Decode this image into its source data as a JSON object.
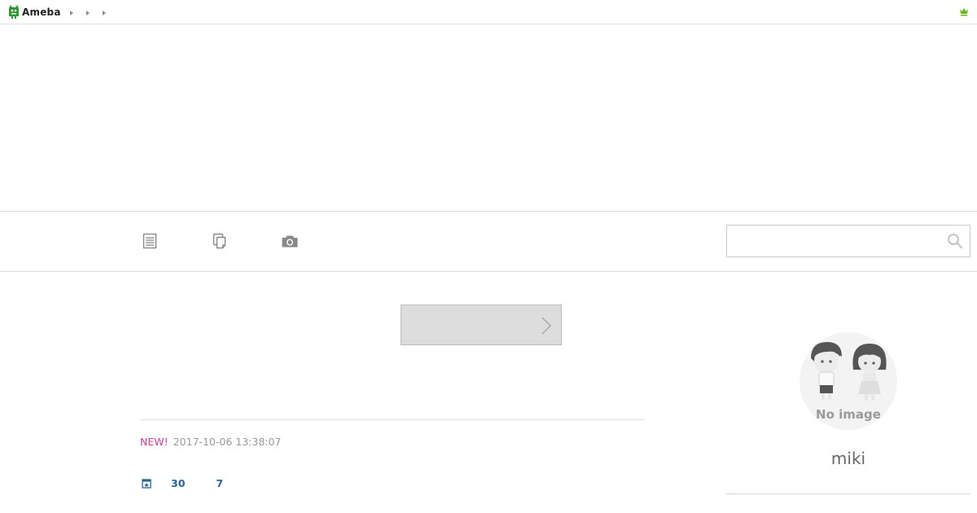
{
  "header": {
    "logo_text": "Ameba",
    "breadcrumbs": [
      "",
      "",
      ""
    ],
    "logo_color": "#2f9a2f",
    "crown_color": "#6bb51f"
  },
  "nav": {
    "items": [
      {
        "name": "entries",
        "icon": "document-list-icon"
      },
      {
        "name": "themes",
        "icon": "copy-pages-icon"
      },
      {
        "name": "photos",
        "icon": "camera-icon"
      }
    ],
    "search": {
      "placeholder": "",
      "value": "",
      "icon": "search-icon"
    }
  },
  "main": {
    "button_label": "",
    "entry": {
      "new_label": "NEW!",
      "date": "2017-10-06 13:38:07",
      "stat_1": "30",
      "stat_2": "7",
      "accent_color": "#d43c96",
      "link_color": "#2a6496"
    }
  },
  "profile": {
    "name": "miki",
    "avatar_caption": "No image"
  }
}
